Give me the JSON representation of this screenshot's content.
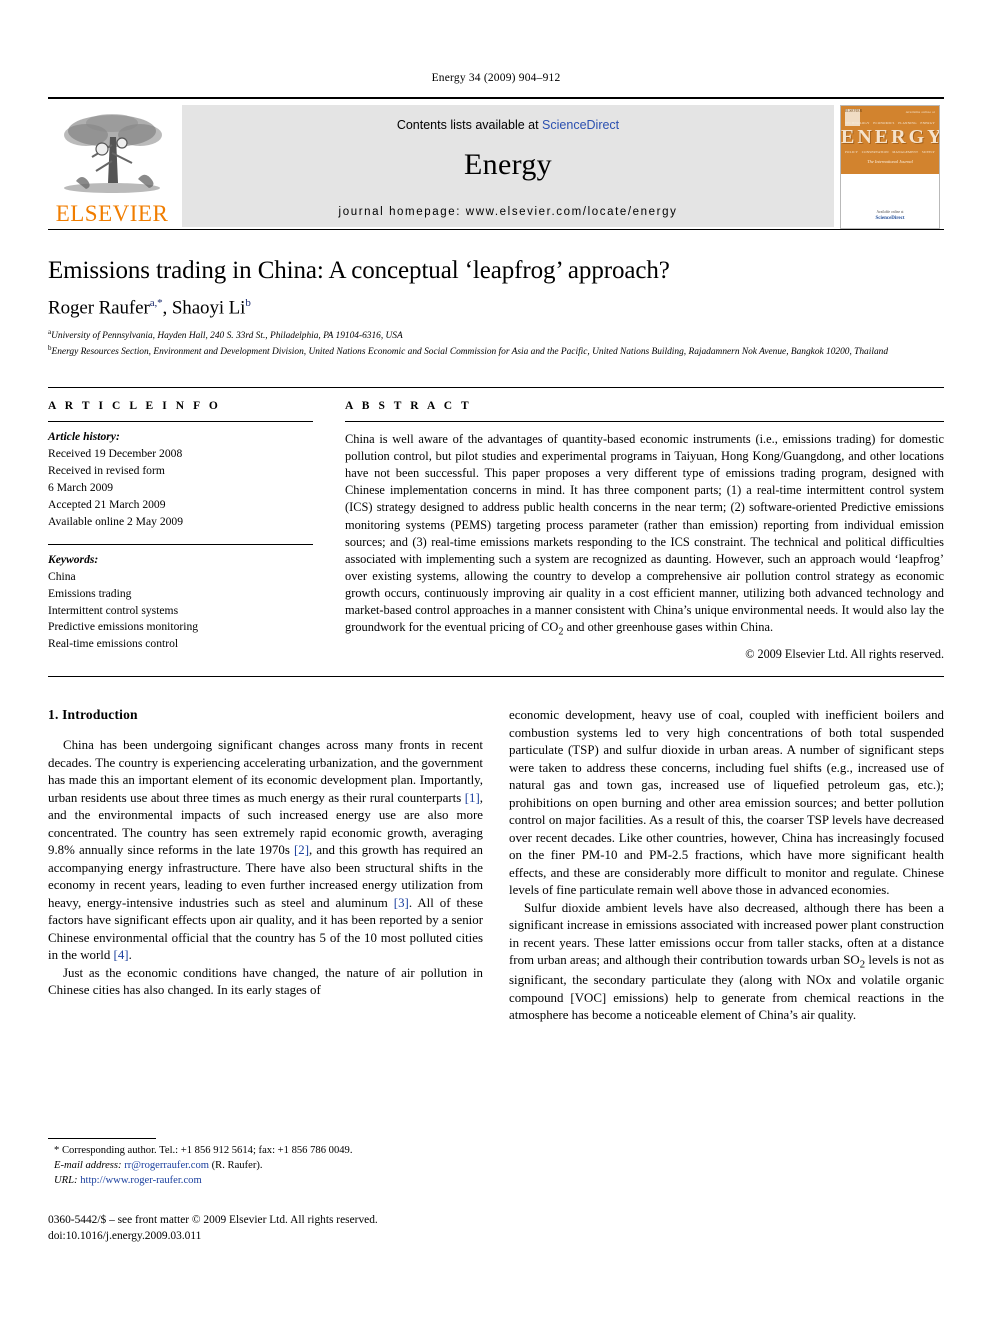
{
  "running_head": "Energy 34 (2009) 904–912",
  "banner": {
    "publisher_name": "ELSEVIER",
    "contents_prefix": "Contents lists available at ",
    "contents_link": "ScienceDirect",
    "journal_name": "Energy",
    "homepage": "journal homepage: www.elsevier.com/locate/energy",
    "cover": {
      "brand": "ELSEVIER",
      "title": "ENERGY",
      "subtitle": "The International Journal",
      "keywords_top": [
        "TECHNOLOGY",
        "ECONOMICS",
        "PLANNING",
        "ENERGY"
      ],
      "keywords_bottom": [
        "POLICY",
        "CONSERVATION",
        "MANAGEMENT",
        "SUPPLY"
      ],
      "issn_note": "Available online at",
      "platform": "ScienceDirect"
    }
  },
  "article": {
    "title": "Emissions trading in China: A conceptual ‘leapfrog’ approach?",
    "authors": [
      {
        "name": "Roger Raufer",
        "marks": "a,*"
      },
      {
        "name": "Shaoyi Li",
        "marks": "b"
      }
    ],
    "affiliations": [
      {
        "mark": "a",
        "text": "University of Pennsylvania, Hayden Hall, 240 S. 33rd St., Philadelphia, PA 19104-6316, USA"
      },
      {
        "mark": "b",
        "text": "Energy Resources Section, Environment and Development Division, United Nations Economic and Social Commission for Asia and the Pacific, United Nations Building, Rajadamnern Nok Avenue, Bangkok 10200, Thailand"
      }
    ]
  },
  "article_info": {
    "heading": "A R T I C L E   I N F O",
    "history_label": "Article history:",
    "history": [
      "Received 19 December 2008",
      "Received in revised form",
      "6 March 2009",
      "Accepted 21 March 2009",
      "Available online 2 May 2009"
    ],
    "keywords_label": "Keywords:",
    "keywords": [
      "China",
      "Emissions trading",
      "Intermittent control systems",
      "Predictive emissions monitoring",
      "Real-time emissions control"
    ]
  },
  "abstract": {
    "heading": "A B S T R A C T",
    "text": "China is well aware of the advantages of quantity-based economic instruments (i.e., emissions trading) for domestic pollution control, but pilot studies and experimental programs in Taiyuan, Hong Kong/Guangdong, and other locations have not been successful. This paper proposes a very different type of emissions trading program, designed with Chinese implementation concerns in mind. It has three component parts; (1) a real-time intermittent control system (ICS) strategy designed to address public health concerns in the near term; (2) software-oriented Predictive emissions monitoring systems (PEMS) targeting process parameter (rather than emission) reporting from individual emission sources; and (3) real-time emissions markets responding to the ICS constraint. The technical and political difficulties associated with implementing such a system are recognized as daunting. However, such an approach would ‘leapfrog’ over existing systems, allowing the country to develop a comprehensive air pollution control strategy as economic growth occurs, continuously improving air quality in a cost efficient manner, utilizing both advanced technology and market-based control approaches in a manner consistent with China’s unique environmental needs. It would also lay the groundwork for the eventual pricing of CO",
    "text_sub": "2",
    "text_tail": " and other greenhouse gases within China.",
    "copyright": "© 2009 Elsevier Ltd. All rights reserved."
  },
  "body": {
    "section_heading": "1. Introduction",
    "left_paragraphs": [
      {
        "segments": [
          {
            "t": "China has been undergoing significant changes across many fronts in recent decades. The country is experiencing accelerating urbanization, and the government has made this an important element of its economic development plan. Importantly, urban residents use about three times as much energy as their rural counterparts "
          },
          {
            "t": "[1]",
            "ref": true
          },
          {
            "t": ", and the environmental impacts of such increased energy use are also more concentrated. The country has seen extremely rapid economic growth, averaging 9.8% annually since reforms in the late 1970s "
          },
          {
            "t": "[2]",
            "ref": true
          },
          {
            "t": ", and this growth has required an accompanying energy infrastructure. There have also been structural shifts in the economy in recent years, leading to even further increased energy utilization from heavy, energy-intensive industries such as steel and aluminum "
          },
          {
            "t": "[3]",
            "ref": true
          },
          {
            "t": ". All of these factors have significant effects upon air quality, and it has been reported by a senior Chinese environmental official that the country has 5 of the 10 most polluted cities in the world "
          },
          {
            "t": "[4]",
            "ref": true
          },
          {
            "t": "."
          }
        ]
      },
      {
        "segments": [
          {
            "t": "Just as the economic conditions have changed, the nature of air pollution in Chinese cities has also changed. In its early stages of"
          }
        ]
      }
    ],
    "right_paragraphs": [
      {
        "segments": [
          {
            "t": "economic development, heavy use of coal, coupled with inefficient boilers and combustion systems led to very high concentrations of both total suspended particulate (TSP) and sulfur dioxide in urban areas. A number of significant steps were taken to address these concerns, including fuel shifts (e.g., increased use of natural gas and town gas, increased use of liquefied petroleum gas, etc.); prohibitions on open burning and other area emission sources; and better pollution control on major facilities. As a result of this, the coarser TSP levels have decreased over recent decades. Like other countries, however, China has increasingly focused on the finer PM-10 and PM-2.5 fractions, which have more significant health effects, and these are considerably more difficult to monitor and regulate. Chinese levels of fine particulate remain well above those in advanced economies."
          }
        ],
        "indent": false
      },
      {
        "segments": [
          {
            "t": "Sulfur dioxide ambient levels have also decreased, although there has been a significant increase in emissions associated with increased power plant construction in recent years. These latter emissions occur from taller stacks, often at a distance from urban areas; and although their contribution towards urban SO"
          },
          {
            "t": "2",
            "sub": true
          },
          {
            "t": " levels is not as significant, the secondary particulate they (along with NOx and volatile organic compound [VOC] emissions) help to generate from chemical reactions in the atmosphere has become a noticeable element of China’s air quality."
          }
        ],
        "indent": true
      }
    ]
  },
  "footnotes": {
    "corresponding": "* Corresponding author. Tel.: +1 856 912 5614; fax: +1 856 786 0049.",
    "email_label": "E-mail address:",
    "email": "rr@rogerraufer.com",
    "email_owner": "(R. Raufer).",
    "url_label": "URL:",
    "url": "http://www.roger-raufer.com"
  },
  "imprint": {
    "line1": "0360-5442/$ – see front matter © 2009 Elsevier Ltd. All rights reserved.",
    "line2": "doi:10.1016/j.energy.2009.03.011"
  }
}
